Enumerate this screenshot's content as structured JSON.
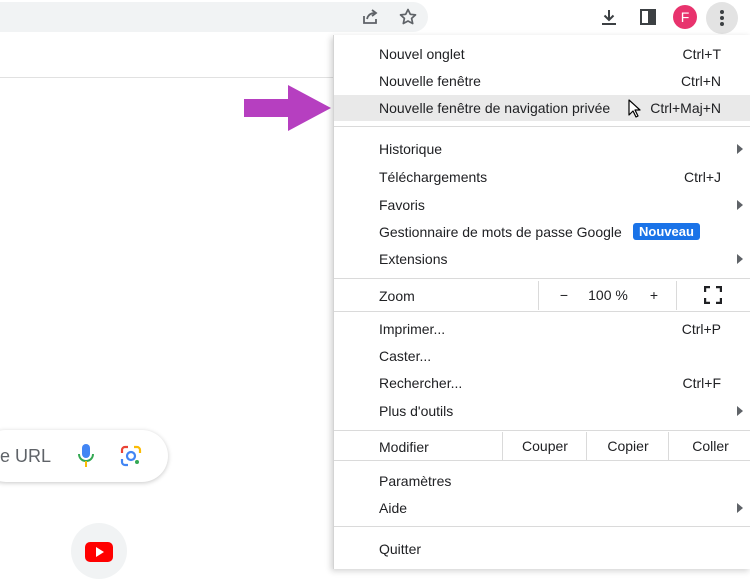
{
  "toolbar": {
    "icons": [
      "share-icon",
      "star-icon",
      "download-icon",
      "side-panel-icon",
      "kebab-menu-icon"
    ],
    "avatar_letter": "F",
    "avatar_color": "#e8336d"
  },
  "page": {
    "search_text": "e URL",
    "shortcut": "youtube-icon"
  },
  "menu": {
    "groups": [
      [
        {
          "label": "Nouvel onglet",
          "shortcut": "Ctrl+T"
        },
        {
          "label": "Nouvelle fenêtre",
          "shortcut": "Ctrl+N"
        },
        {
          "label": "Nouvelle fenêtre de navigation privée",
          "shortcut": "Ctrl+Maj+N",
          "highlighted": true
        }
      ],
      [
        {
          "label": "Historique",
          "submenu": true
        },
        {
          "label": "Téléchargements",
          "shortcut": "Ctrl+J"
        },
        {
          "label": "Favoris",
          "submenu": true
        },
        {
          "label": "Gestionnaire de mots de passe Google",
          "badge": "Nouveau"
        },
        {
          "label": "Extensions",
          "submenu": true
        }
      ]
    ],
    "zoom": {
      "label": "Zoom",
      "minus": "−",
      "value": "100 %",
      "plus": "+"
    },
    "tools": [
      {
        "label": "Imprimer...",
        "shortcut": "Ctrl+P"
      },
      {
        "label": "Caster..."
      },
      {
        "label": "Rechercher...",
        "shortcut": "Ctrl+F"
      },
      {
        "label": "Plus d'outils",
        "submenu": true
      }
    ],
    "edit": {
      "label": "Modifier",
      "cut": "Couper",
      "copy": "Copier",
      "paste": "Coller"
    },
    "settings": [
      {
        "label": "Paramètres"
      },
      {
        "label": "Aide",
        "submenu": true
      }
    ],
    "quit": {
      "label": "Quitter"
    }
  },
  "colors": {
    "arrow": "#b63fc0",
    "badge": "#1a73e8",
    "highlight": "#e9e9e9"
  }
}
